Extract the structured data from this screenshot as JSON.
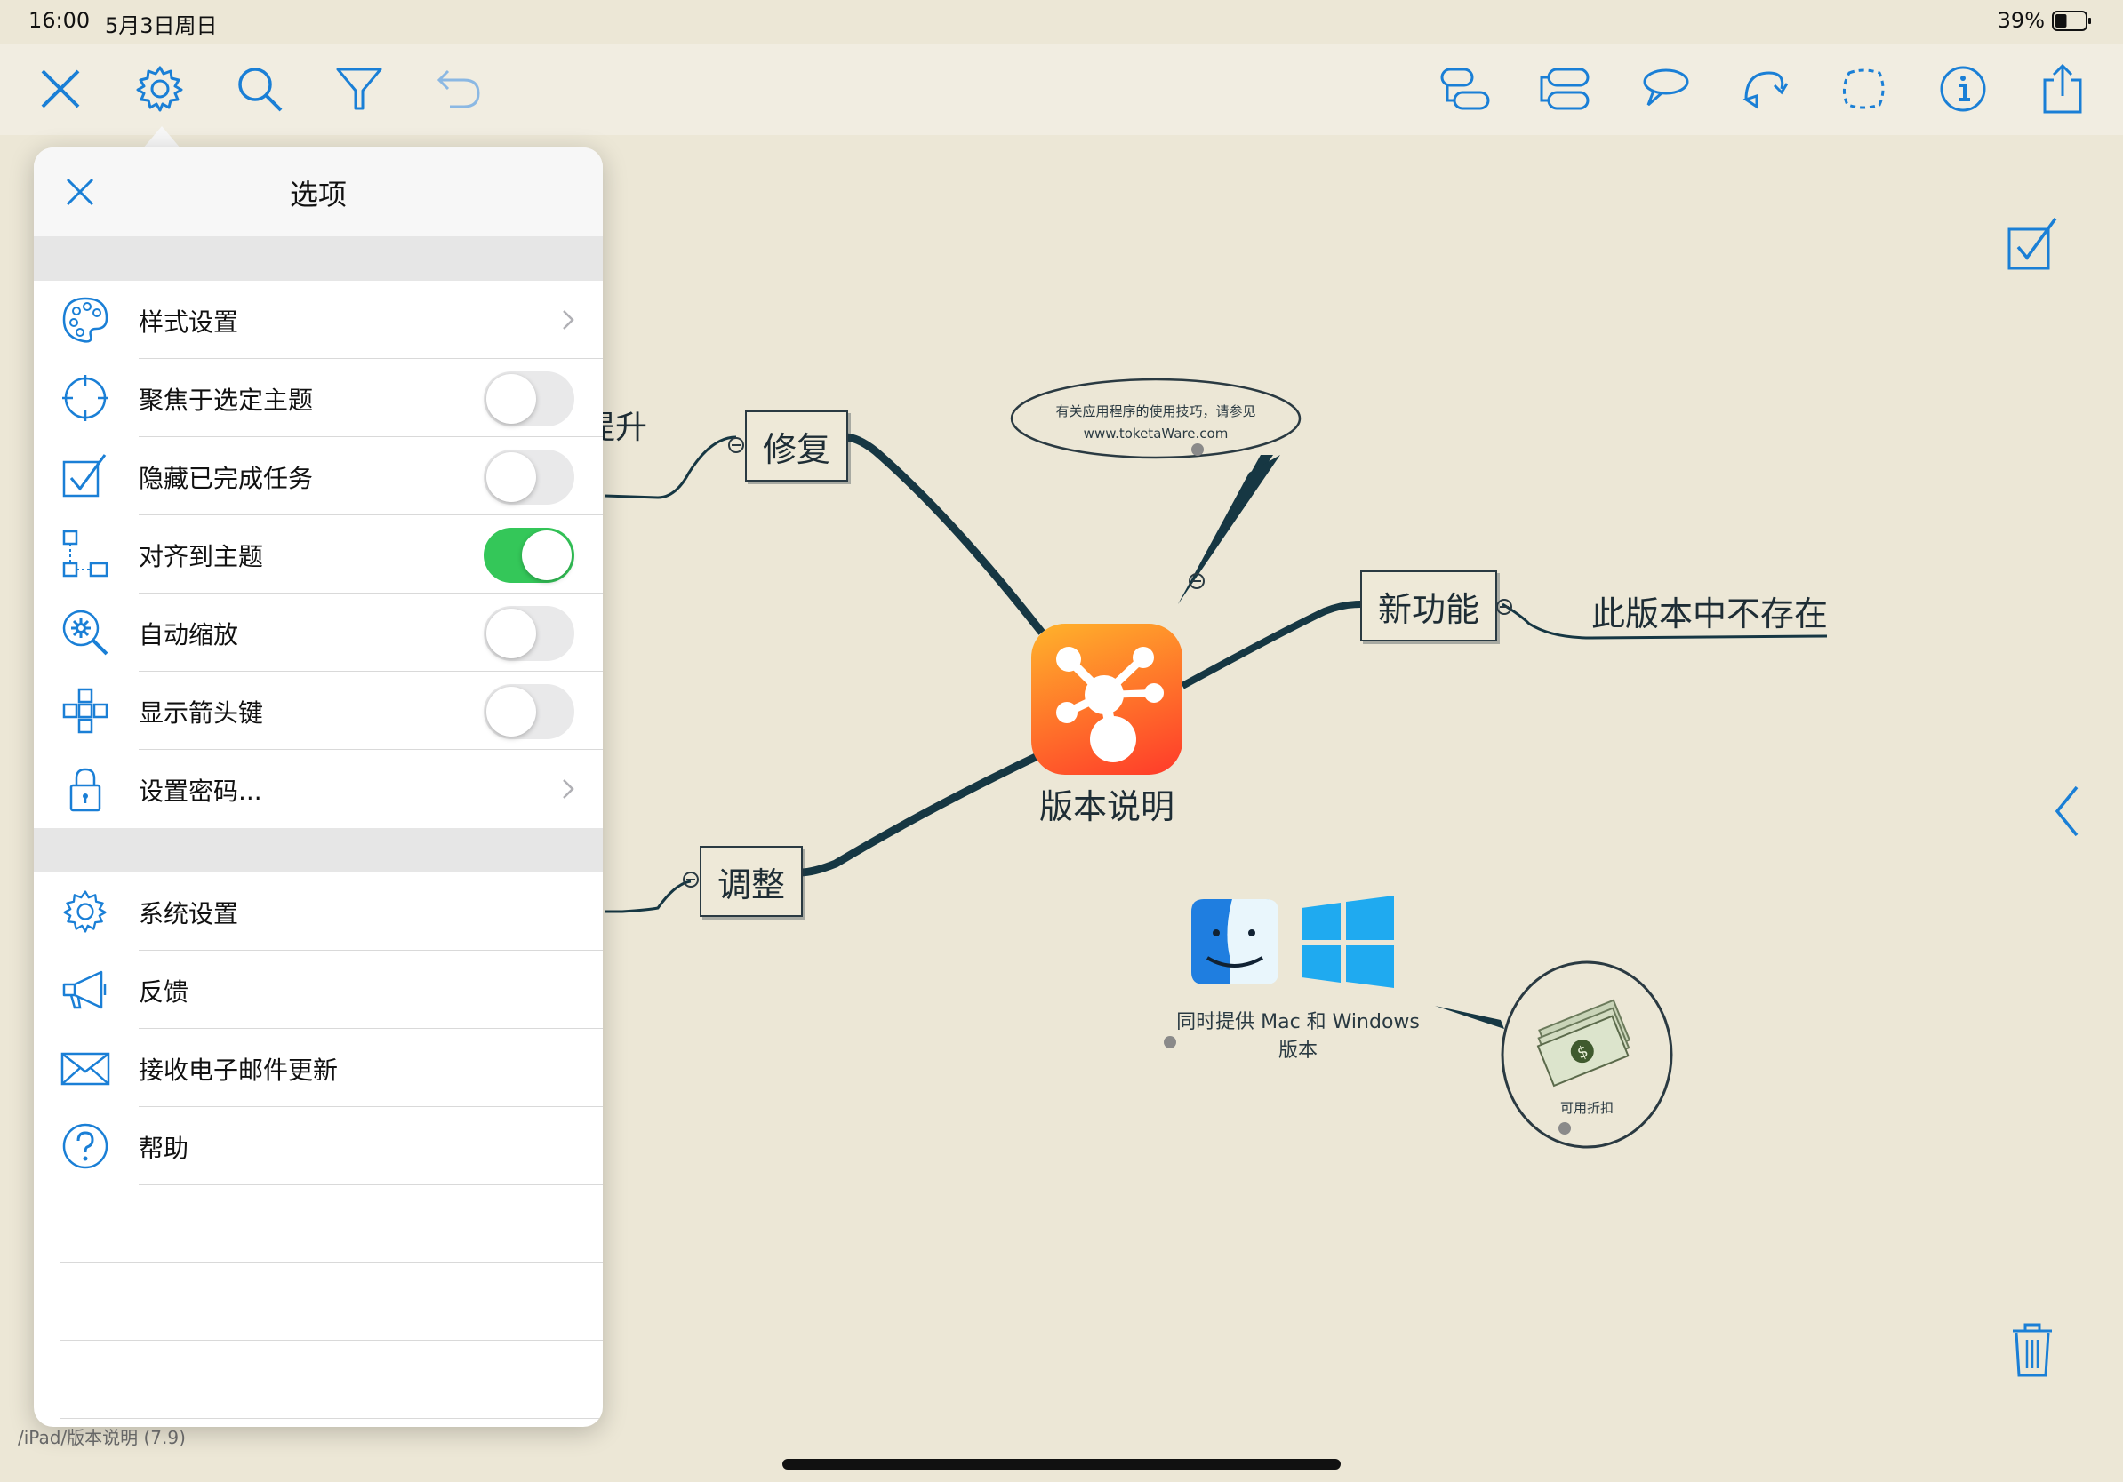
{
  "status": {
    "time": "16:00",
    "date": "5月3日周日",
    "battery": "39%",
    "battery_level": 0.39
  },
  "toolbar": {
    "left": [
      "close-icon",
      "gear-icon",
      "search-icon",
      "filter-icon",
      "undo-icon"
    ],
    "right": [
      "add-subtopic-icon",
      "add-topic-icon",
      "callout-icon",
      "relationship-icon",
      "boundary-icon",
      "info-icon",
      "share-icon"
    ]
  },
  "options": {
    "title": "选项",
    "rows": [
      {
        "label": "样式设置",
        "icon": "palette-icon",
        "control": "chevron"
      },
      {
        "label": "聚焦于选定主题",
        "icon": "crosshair-icon",
        "control": "toggle",
        "on": false
      },
      {
        "label": "隐藏已完成任务",
        "icon": "checkbox-icon",
        "control": "toggle",
        "on": false
      },
      {
        "label": "对齐到主题",
        "icon": "align-icon",
        "control": "toggle",
        "on": true
      },
      {
        "label": "自动缩放",
        "icon": "zoom-gear-icon",
        "control": "toggle",
        "on": false
      },
      {
        "label": "显示箭头键",
        "icon": "arrow-keys-icon",
        "control": "toggle",
        "on": false
      },
      {
        "label": "设置密码...",
        "icon": "lock-icon",
        "control": "chevron"
      }
    ],
    "rows2": [
      {
        "label": "系统设置",
        "icon": "gear-icon"
      },
      {
        "label": "反馈",
        "icon": "megaphone-icon"
      },
      {
        "label": "接收电子邮件更新",
        "icon": "mail-icon"
      },
      {
        "label": "帮助",
        "icon": "help-icon"
      }
    ]
  },
  "mindmap": {
    "central": "版本说明",
    "fix": "修复",
    "adjust": "调整",
    "new_features": "新功能",
    "not_exist": "此版本中不存在",
    "partial_left": "提升",
    "callout_line1": "有关应用程序的使用技巧，请参见",
    "callout_line2": "www.toketaWare.com",
    "platforms": "同时提供 Mac 和 Windows 版本",
    "discount": "可用折扣"
  },
  "footer": {
    "path": "/iPad/版本说明 (7.9)"
  },
  "colors": {
    "accent": "#1a7fd6",
    "toggle_on": "#34c759",
    "canvas": "#ece7d6",
    "branch": "#163743"
  }
}
